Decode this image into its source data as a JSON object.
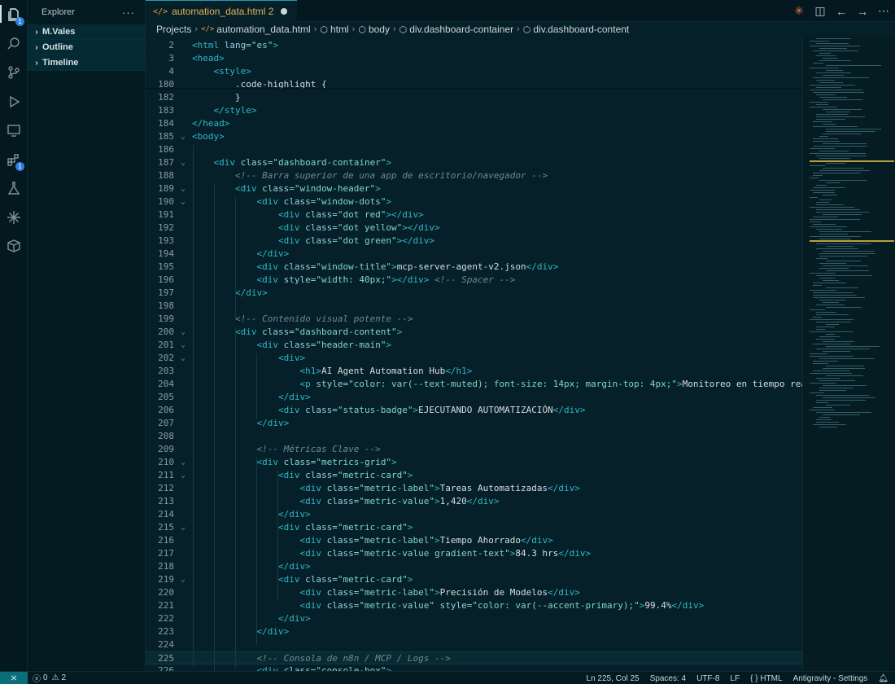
{
  "sidebar": {
    "title": "Explorer",
    "more": "···",
    "sections": [
      {
        "label": "M.Vales"
      },
      {
        "label": "Outline"
      },
      {
        "label": "Timeline"
      }
    ]
  },
  "activity_bar": {
    "explorer_badge": "1",
    "extensions_badge": "1"
  },
  "tab": {
    "icon": "</>",
    "label": "automation_data.html 2",
    "dirty": true
  },
  "breadcrumb": [
    "Projects",
    "automation_data.html",
    "html",
    "body",
    "div.dashboard-container",
    "div.dashboard-content"
  ],
  "editor": {
    "sticky_lines": [
      {
        "n": "2",
        "tokens": [
          [
            "tag",
            "<html"
          ],
          [
            "attr",
            " lang="
          ],
          [
            "str",
            "\"es\""
          ],
          [
            "tag",
            ">"
          ]
        ]
      },
      {
        "n": "3",
        "tokens": [
          [
            "tag",
            "<head>"
          ]
        ]
      },
      {
        "n": "4",
        "tokens": [
          [
            "txt",
            "    "
          ],
          [
            "tag",
            "<style>"
          ]
        ]
      },
      {
        "n": "180",
        "tokens": [
          [
            "txt",
            "        .code-highlight {"
          ]
        ]
      }
    ],
    "lines": [
      {
        "n": "182",
        "tokens": [
          [
            "txt",
            "        }"
          ]
        ]
      },
      {
        "n": "183",
        "tokens": [
          [
            "txt",
            "    "
          ],
          [
            "tag",
            "</style>"
          ]
        ]
      },
      {
        "n": "184",
        "tokens": [
          [
            "tag",
            "</head>"
          ]
        ]
      },
      {
        "n": "185",
        "fold": true,
        "tokens": [
          [
            "tag",
            "<body>"
          ]
        ]
      },
      {
        "n": "186",
        "tokens": []
      },
      {
        "n": "187",
        "fold": true,
        "tokens": [
          [
            "txt",
            "    "
          ],
          [
            "tag",
            "<div"
          ],
          [
            "attr",
            " class="
          ],
          [
            "str",
            "\"dashboard-container\""
          ],
          [
            "tag",
            ">"
          ]
        ]
      },
      {
        "n": "188",
        "tokens": [
          [
            "txt",
            "        "
          ],
          [
            "com",
            "<!-- Barra superior de una app de escritorio/navegador -->"
          ]
        ]
      },
      {
        "n": "189",
        "fold": true,
        "tokens": [
          [
            "txt",
            "        "
          ],
          [
            "tag",
            "<div"
          ],
          [
            "attr",
            " class="
          ],
          [
            "str",
            "\"window-header\""
          ],
          [
            "tag",
            ">"
          ]
        ]
      },
      {
        "n": "190",
        "fold": true,
        "tokens": [
          [
            "txt",
            "            "
          ],
          [
            "tag",
            "<div"
          ],
          [
            "attr",
            " class="
          ],
          [
            "str",
            "\"window-dots\""
          ],
          [
            "tag",
            ">"
          ]
        ]
      },
      {
        "n": "191",
        "tokens": [
          [
            "txt",
            "                "
          ],
          [
            "tag",
            "<div"
          ],
          [
            "attr",
            " class="
          ],
          [
            "str",
            "\"dot red\""
          ],
          [
            "tag",
            "></div>"
          ]
        ]
      },
      {
        "n": "192",
        "tokens": [
          [
            "txt",
            "                "
          ],
          [
            "tag",
            "<div"
          ],
          [
            "attr",
            " class="
          ],
          [
            "str",
            "\"dot yellow\""
          ],
          [
            "tag",
            "></div>"
          ]
        ]
      },
      {
        "n": "193",
        "tokens": [
          [
            "txt",
            "                "
          ],
          [
            "tag",
            "<div"
          ],
          [
            "attr",
            " class="
          ],
          [
            "str",
            "\"dot green\""
          ],
          [
            "tag",
            "></div>"
          ]
        ]
      },
      {
        "n": "194",
        "tokens": [
          [
            "txt",
            "            "
          ],
          [
            "tag",
            "</div>"
          ]
        ]
      },
      {
        "n": "195",
        "tokens": [
          [
            "txt",
            "            "
          ],
          [
            "tag",
            "<div"
          ],
          [
            "attr",
            " class="
          ],
          [
            "str",
            "\"window-title\""
          ],
          [
            "tag",
            ">"
          ],
          [
            "txt",
            "mcp-server-agent-v2.json"
          ],
          [
            "tag",
            "</div>"
          ]
        ]
      },
      {
        "n": "196",
        "tokens": [
          [
            "txt",
            "            "
          ],
          [
            "tag",
            "<div"
          ],
          [
            "attr",
            " style="
          ],
          [
            "str",
            "\"width: 40px;\""
          ],
          [
            "tag",
            "></div>"
          ],
          [
            "txt",
            " "
          ],
          [
            "com",
            "<!-- Spacer -->"
          ]
        ]
      },
      {
        "n": "197",
        "tokens": [
          [
            "txt",
            "        "
          ],
          [
            "tag",
            "</div>"
          ]
        ]
      },
      {
        "n": "198",
        "tokens": []
      },
      {
        "n": "199",
        "tokens": [
          [
            "txt",
            "        "
          ],
          [
            "com",
            "<!-- Contenido visual potente -->"
          ]
        ]
      },
      {
        "n": "200",
        "fold": true,
        "tokens": [
          [
            "txt",
            "        "
          ],
          [
            "tag",
            "<div"
          ],
          [
            "attr",
            " class="
          ],
          [
            "str",
            "\"dashboard-content\""
          ],
          [
            "tag",
            ">"
          ]
        ]
      },
      {
        "n": "201",
        "fold": true,
        "tokens": [
          [
            "txt",
            "            "
          ],
          [
            "tag",
            "<div"
          ],
          [
            "attr",
            " class="
          ],
          [
            "str",
            "\"header-main\""
          ],
          [
            "tag",
            ">"
          ]
        ]
      },
      {
        "n": "202",
        "fold": true,
        "tokens": [
          [
            "txt",
            "                "
          ],
          [
            "tag",
            "<div>"
          ]
        ]
      },
      {
        "n": "203",
        "tokens": [
          [
            "txt",
            "                    "
          ],
          [
            "tag",
            "<h1>"
          ],
          [
            "txt",
            "AI Agent Automation Hub"
          ],
          [
            "tag",
            "</h1>"
          ]
        ]
      },
      {
        "n": "204",
        "tokens": [
          [
            "txt",
            "                    "
          ],
          [
            "tag",
            "<p"
          ],
          [
            "attr",
            " style="
          ],
          [
            "str",
            "\"color: var(--text-muted); font-size: 14px; margin-top: 4px;\""
          ],
          [
            "tag",
            ">"
          ],
          [
            "txt",
            "Monitoreo en tiempo real"
          ]
        ]
      },
      {
        "n": "205",
        "tokens": [
          [
            "txt",
            "                "
          ],
          [
            "tag",
            "</div>"
          ]
        ]
      },
      {
        "n": "206",
        "tokens": [
          [
            "txt",
            "                "
          ],
          [
            "tag",
            "<div"
          ],
          [
            "attr",
            " class="
          ],
          [
            "str",
            "\"status-badge\""
          ],
          [
            "tag",
            ">"
          ],
          [
            "txt",
            "EJECUTANDO AUTOMATIZACIÓN"
          ],
          [
            "tag",
            "</div>"
          ]
        ]
      },
      {
        "n": "207",
        "tokens": [
          [
            "txt",
            "            "
          ],
          [
            "tag",
            "</div>"
          ]
        ]
      },
      {
        "n": "208",
        "tokens": []
      },
      {
        "n": "209",
        "tokens": [
          [
            "txt",
            "            "
          ],
          [
            "com",
            "<!-- Métricas Clave -->"
          ]
        ]
      },
      {
        "n": "210",
        "fold": true,
        "tokens": [
          [
            "txt",
            "            "
          ],
          [
            "tag",
            "<div"
          ],
          [
            "attr",
            " class="
          ],
          [
            "str",
            "\"metrics-grid\""
          ],
          [
            "tag",
            ">"
          ]
        ]
      },
      {
        "n": "211",
        "fold": true,
        "tokens": [
          [
            "txt",
            "                "
          ],
          [
            "tag",
            "<div"
          ],
          [
            "attr",
            " class="
          ],
          [
            "str",
            "\"metric-card\""
          ],
          [
            "tag",
            ">"
          ]
        ]
      },
      {
        "n": "212",
        "tokens": [
          [
            "txt",
            "                    "
          ],
          [
            "tag",
            "<div"
          ],
          [
            "attr",
            " class="
          ],
          [
            "str",
            "\"metric-label\""
          ],
          [
            "tag",
            ">"
          ],
          [
            "txt",
            "Tareas Automatizadas"
          ],
          [
            "tag",
            "</div>"
          ]
        ]
      },
      {
        "n": "213",
        "tokens": [
          [
            "txt",
            "                    "
          ],
          [
            "tag",
            "<div"
          ],
          [
            "attr",
            " class="
          ],
          [
            "str",
            "\"metric-value\""
          ],
          [
            "tag",
            ">"
          ],
          [
            "txt",
            "1,420"
          ],
          [
            "tag",
            "</div>"
          ]
        ]
      },
      {
        "n": "214",
        "tokens": [
          [
            "txt",
            "                "
          ],
          [
            "tag",
            "</div>"
          ]
        ]
      },
      {
        "n": "215",
        "fold": true,
        "tokens": [
          [
            "txt",
            "                "
          ],
          [
            "tag",
            "<div"
          ],
          [
            "attr",
            " class="
          ],
          [
            "str",
            "\"metric-card\""
          ],
          [
            "tag",
            ">"
          ]
        ]
      },
      {
        "n": "216",
        "tokens": [
          [
            "txt",
            "                    "
          ],
          [
            "tag",
            "<div"
          ],
          [
            "attr",
            " class="
          ],
          [
            "str",
            "\"metric-label\""
          ],
          [
            "tag",
            ">"
          ],
          [
            "txt",
            "Tiempo Ahorrado"
          ],
          [
            "tag",
            "</div>"
          ]
        ]
      },
      {
        "n": "217",
        "tokens": [
          [
            "txt",
            "                    "
          ],
          [
            "tag",
            "<div"
          ],
          [
            "attr",
            " class="
          ],
          [
            "str",
            "\"metric-value gradient-text\""
          ],
          [
            "tag",
            ">"
          ],
          [
            "txt",
            "84.3 hrs"
          ],
          [
            "tag",
            "</div>"
          ]
        ]
      },
      {
        "n": "218",
        "tokens": [
          [
            "txt",
            "                "
          ],
          [
            "tag",
            "</div>"
          ]
        ]
      },
      {
        "n": "219",
        "fold": true,
        "tokens": [
          [
            "txt",
            "                "
          ],
          [
            "tag",
            "<div"
          ],
          [
            "attr",
            " class="
          ],
          [
            "str",
            "\"metric-card\""
          ],
          [
            "tag",
            ">"
          ]
        ]
      },
      {
        "n": "220",
        "tokens": [
          [
            "txt",
            "                    "
          ],
          [
            "tag",
            "<div"
          ],
          [
            "attr",
            " class="
          ],
          [
            "str",
            "\"metric-label\""
          ],
          [
            "tag",
            ">"
          ],
          [
            "txt",
            "Precisión de Modelos"
          ],
          [
            "tag",
            "</div>"
          ]
        ]
      },
      {
        "n": "221",
        "tokens": [
          [
            "txt",
            "                    "
          ],
          [
            "tag",
            "<div"
          ],
          [
            "attr",
            " class="
          ],
          [
            "str",
            "\"metric-value\""
          ],
          [
            "attr",
            " style="
          ],
          [
            "str",
            "\"color: var(--accent-primary);\""
          ],
          [
            "tag",
            ">"
          ],
          [
            "txt",
            "99.4%"
          ],
          [
            "tag",
            "</div>"
          ]
        ]
      },
      {
        "n": "222",
        "tokens": [
          [
            "txt",
            "                "
          ],
          [
            "tag",
            "</div>"
          ]
        ]
      },
      {
        "n": "223",
        "tokens": [
          [
            "txt",
            "            "
          ],
          [
            "tag",
            "</div>"
          ]
        ]
      },
      {
        "n": "224",
        "tokens": []
      },
      {
        "n": "225",
        "current": true,
        "tokens": [
          [
            "txt",
            "            "
          ],
          [
            "com",
            "<!-- Consola de n8n / MCP / Logs -->"
          ]
        ]
      },
      {
        "n": "226",
        "fold": true,
        "tokens": [
          [
            "txt",
            "            "
          ],
          [
            "tag",
            "<div"
          ],
          [
            "attr",
            " class="
          ],
          [
            "str",
            "\"console-box\""
          ],
          [
            "tag",
            ">"
          ]
        ]
      }
    ]
  },
  "statusbar": {
    "errors": "0",
    "warnings": "2",
    "position": "Ln 225, Col 25",
    "spaces": "Spaces: 4",
    "encoding": "UTF-8",
    "eol": "LF",
    "language": "HTML",
    "brackets": "{ }",
    "settings": "Antigravity - Settings"
  },
  "colors": {
    "background": "#062029",
    "tag": "#2fb8c9",
    "string": "#7fd6c9",
    "comment": "#6b8a90",
    "tab_label": "#e2b35a"
  }
}
